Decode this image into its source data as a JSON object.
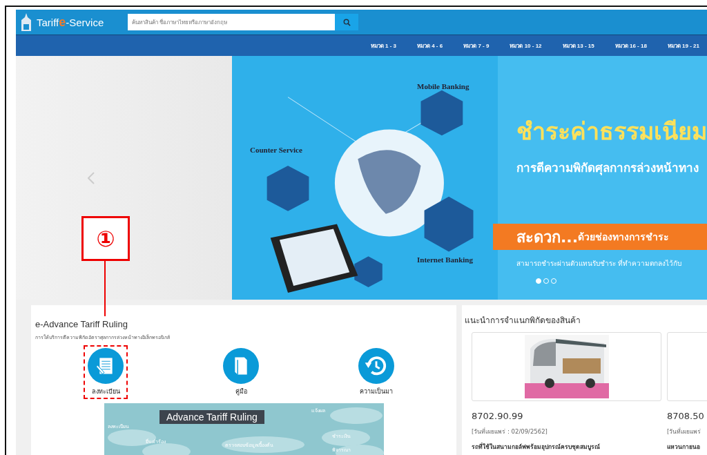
{
  "header": {
    "logo": {
      "prefix": "Tariff",
      "middle": "e",
      "suffix": "-Service"
    },
    "search": {
      "placeholder": "ค้นหาสินค้า ชื่อภาษาไทยหรือภาษาอังกฤษ"
    }
  },
  "nav": [
    "หมวด 1 - 3",
    "หมวด 4 - 6",
    "หมวด 7 - 9",
    "หมวด 10 - 12",
    "หมวด 13 - 15",
    "หมวด 16 - 18",
    "หมวด 19 - 21"
  ],
  "banner": {
    "labels": [
      "Mobile Banking",
      "Counter Service",
      "Internet Banking"
    ],
    "headline": "ชำระค่าธรรมเนียม",
    "subheadline": "การตีความพิกัดศุลกากรล่วงหน้าทาง",
    "strip_bold": "สะดวก...",
    "strip_text": "ด้วยช่องทางการชำระ",
    "note": "สามารถชำระผ่านตัวแทนรับชำระ  ที่ทำความตกลงไว้กับ",
    "dots": [
      {
        "selected": true
      },
      {
        "selected": false
      },
      {
        "selected": false
      }
    ]
  },
  "annotation": {
    "marker": "①"
  },
  "ruling": {
    "title": "e-Advance Tariff Ruling",
    "subtitle": "การให้บริการตีความพิกัดอัตราศุลกากรล่วงหน้าทางอิเล็กทรอนิกส์",
    "actions": [
      {
        "kind": "register",
        "label": "ลงทะเบียน",
        "highlighted": true
      },
      {
        "kind": "manual",
        "label": "คู่มือ",
        "highlighted": false
      },
      {
        "kind": "history",
        "label": "ความเป็นมา",
        "highlighted": false
      }
    ],
    "infographic": {
      "title": "Advance Tariff Ruling",
      "clouds": [
        "ลงทะเบียน",
        "ยื่นคำร้อง",
        "ตรวจสอบข้อมูลเบื้องต้น",
        "ชำระเงิน",
        "แจ้งผล",
        "พิจารณา"
      ]
    }
  },
  "products": {
    "title": "แนะนำการจำแนกพิกัดของสินค้า",
    "items": [
      {
        "code": "8702.90.99",
        "date": "[วันที่เผยแพร่ : 02/09/2562]",
        "name": "รถที่ใช้ในสนามกอล์ฟพร้อมอุปกรณ์ครบชุดสมบูรณ์"
      },
      {
        "code": "8708.50",
        "date": "[วันที่เผยแพร่",
        "name": "แหวนกายนอ"
      }
    ]
  }
}
